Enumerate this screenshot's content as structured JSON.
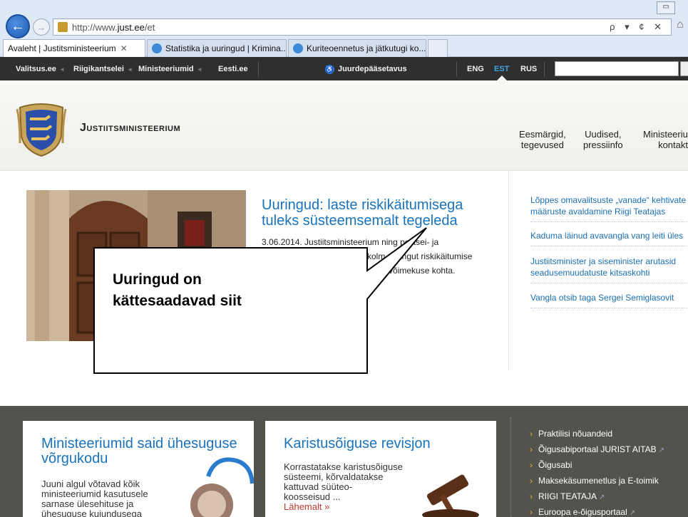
{
  "browser": {
    "url_prefix": "http://www.",
    "url_domain": "just.ee",
    "url_path": "/et",
    "address_tools": "ρ ▾ ¢ ✕",
    "tabs": [
      {
        "label": "Avaleht | Justitsministeerium",
        "active": true
      },
      {
        "label": "Statistika ja uuringud | Krimina...",
        "active": false
      },
      {
        "label": "Kuriteoennetus ja jätkutugi ko...",
        "active": false
      }
    ]
  },
  "topbar": {
    "links": [
      "Valitsus.ee",
      "Riigikantselei",
      "Ministeeriumid",
      "Eesti.ee"
    ],
    "accessibility": "Juurdepääsetavus",
    "languages": [
      "ENG",
      "EST",
      "RUS"
    ]
  },
  "header": {
    "site_name": "Justiitsministeerium",
    "nav": [
      {
        "line1": "Eesmärgid,",
        "line2": "tegevused"
      },
      {
        "line1": "Uudised,",
        "line2": "pressiinfo"
      },
      {
        "line1": "Ministeerium",
        "line2": "kontakt"
      }
    ]
  },
  "feature": {
    "title": "Uuringud: laste riskikäitumisega tuleks süsteemsemalt tegeleda",
    "line1": "3.06.2014. Justiitsministeerium ning politsei- ja",
    "line2": "kolm uuringut riskikäitumise",
    "line3": "stöö võimekuse kohta."
  },
  "callout": {
    "line1": "Uuringud on",
    "line2": "kättesaadavad siit"
  },
  "news": [
    "Lõppes omavalitsuste „vanade“ kehtivate määruste avaldamine Riigi Teatajas",
    "Kaduma läinud avavangla vang leiti üles",
    "Justiitsminister ja siseminister arutasid seadusemuudatuste kitsaskohti",
    "Vangla otsib taga Sergei Semiglasovit"
  ],
  "cards": [
    {
      "title": "Ministeeriumid said ühesuguse võrgukodu",
      "text": [
        "Juuni algul võtavad kõik",
        "ministeeriumid kasutusele",
        "sarnase ülesehituse ja",
        "ühesuguse kujundusega"
      ]
    },
    {
      "title": "Karistusõiguse revisjon",
      "text": [
        "Korrastatakse karistusõiguse",
        "süsteemi, kõrvaldatakse",
        "kattuvad süüteo-",
        "koosseisud ..."
      ],
      "more": "Lähemalt »"
    }
  ],
  "quick_links": [
    {
      "label": "Praktilisi nõuandeid",
      "external": false
    },
    {
      "label": "Õigusabiportaal JURIST AITAB",
      "external": true
    },
    {
      "label": "Õigusabi",
      "external": false
    },
    {
      "label": "Maksekäsumenetlus ja E-toimik",
      "external": false
    },
    {
      "label": "RIIGI TEATAJA",
      "external": true
    },
    {
      "label": "Euroopa e-õigusportaal",
      "external": true
    }
  ]
}
